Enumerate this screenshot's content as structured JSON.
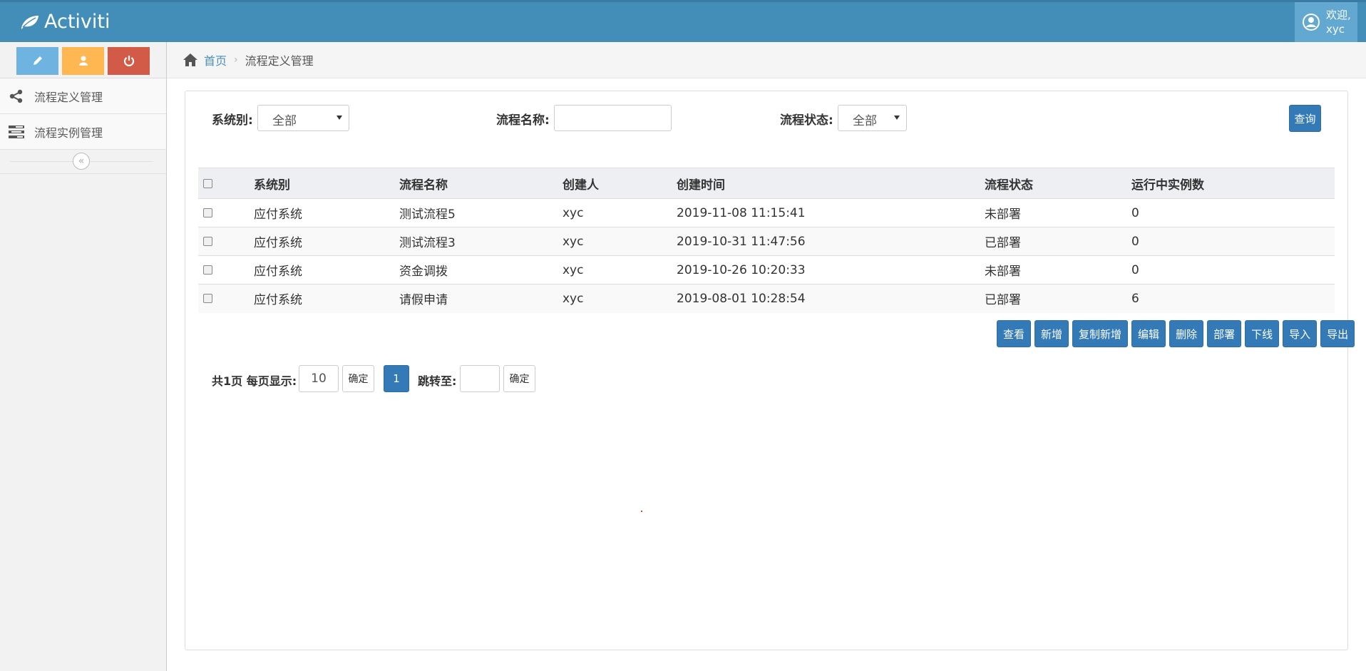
{
  "navbar": {
    "brand": "Activiti",
    "welcome": "欢迎,",
    "username": "xyc"
  },
  "sidebar": {
    "items": [
      {
        "label": "流程定义管理",
        "icon": "share-icon"
      },
      {
        "label": "流程实例管理",
        "icon": "tasks-icon"
      }
    ],
    "collapse_label": "«"
  },
  "breadcrumb": {
    "home": "首页",
    "separator": "›",
    "current": "流程定义管理"
  },
  "filters": {
    "system_label": "系统别:",
    "system_value": "全部",
    "name_label": "流程名称:",
    "name_value": "",
    "status_label": "流程状态:",
    "status_value": "全部",
    "query_button": "查询"
  },
  "table": {
    "headers": [
      "系统别",
      "流程名称",
      "创建人",
      "创建时间",
      "流程状态",
      "运行中实例数"
    ],
    "rows": [
      [
        "应付系统",
        "测试流程5",
        "xyc",
        "2019-11-08 11:15:41",
        "未部署",
        "0"
      ],
      [
        "应付系统",
        "测试流程3",
        "xyc",
        "2019-10-31 11:47:56",
        "已部署",
        "0"
      ],
      [
        "应付系统",
        "资金调拨",
        "xyc",
        "2019-10-26 10:20:33",
        "未部署",
        "0"
      ],
      [
        "应付系统",
        "请假申请",
        "xyc",
        "2019-08-01 10:28:54",
        "已部署",
        "6"
      ]
    ]
  },
  "actions": [
    "查看",
    "新增",
    "复制新增",
    "编辑",
    "删除",
    "部署",
    "下线",
    "导入",
    "导出"
  ],
  "pager": {
    "summary": "共1页 每页显示:",
    "page_size": "10",
    "confirm": "确定",
    "current_page": "1",
    "jump_label": "跳转至:",
    "jump_value": "",
    "jump_confirm": "确定"
  },
  "colors": {
    "navbar": "#438eb9",
    "primary": "#337ab7",
    "info": "#6fb3e0",
    "warning": "#ffb752",
    "danger": "#d15b47"
  }
}
